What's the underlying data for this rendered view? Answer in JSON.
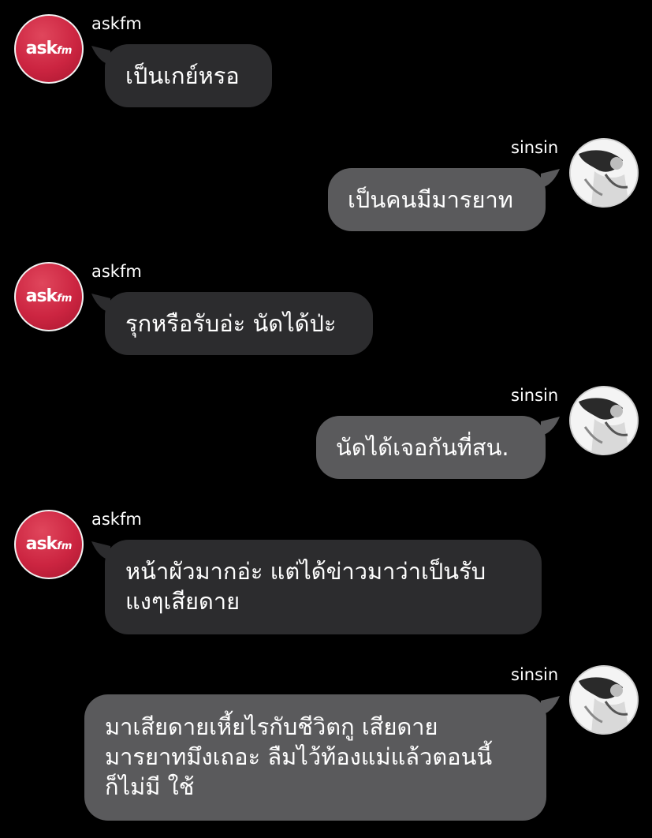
{
  "chat": {
    "messages": [
      {
        "sender": "askfm",
        "avatar_icon": "askfm-logo-icon",
        "avatar_text": "ask",
        "avatar_text_small": "fm",
        "text": "เป็นเกย์หรอ"
      },
      {
        "sender": "sinsin",
        "avatar_icon": "user-photo-icon",
        "text": "เป็นคนมีมารยาท"
      },
      {
        "sender": "askfm",
        "avatar_icon": "askfm-logo-icon",
        "avatar_text": "ask",
        "avatar_text_small": "fm",
        "text": "รุกหรือรับอ่ะ นัดได้ป่ะ"
      },
      {
        "sender": "sinsin",
        "avatar_icon": "user-photo-icon",
        "text": "นัดได้เจอกันที่สน."
      },
      {
        "sender": "askfm",
        "avatar_icon": "askfm-logo-icon",
        "avatar_text": "ask",
        "avatar_text_small": "fm",
        "text": "หน้าผัวมากอ่ะ แต่ได้ข่าวมาว่าเป็นรับ\nแงๆเสียดาย"
      },
      {
        "sender": "sinsin",
        "avatar_icon": "user-photo-icon",
        "text": "มาเสียดายเหี้ยไรกับชีวิตกู เสียดาย\nมารยาทมึงเถอะ ลืมไว้ท้องแม่แล้วตอนนี้\nก็ไม่มี ใช้"
      }
    ]
  },
  "colors": {
    "background": "#000000",
    "incoming_bubble": "#2c2c2e",
    "outgoing_bubble": "#5a5a5c",
    "askfm_brand": "#cc2541",
    "text": "#ffffff"
  }
}
